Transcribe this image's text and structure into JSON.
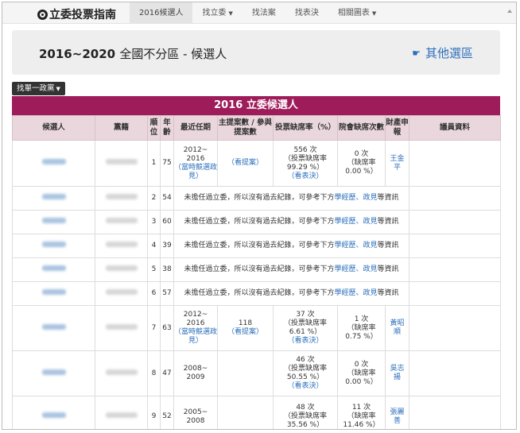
{
  "nav": {
    "brand": "立委投票指南",
    "items": [
      {
        "label": "2016候選人",
        "active": true,
        "caret": false
      },
      {
        "label": "找立委",
        "active": false,
        "caret": true
      },
      {
        "label": "找法案",
        "active": false,
        "caret": false
      },
      {
        "label": "找表決",
        "active": false,
        "caret": false
      },
      {
        "label": "相關圖表",
        "active": false,
        "caret": true
      }
    ]
  },
  "header": {
    "title_bold": "2016~2020",
    "title_normal": "全國不分區 - 候選人",
    "other_link": "其他選區"
  },
  "filter": {
    "label": "找單一政黨"
  },
  "table": {
    "title": "2016 立委候選人",
    "columns": [
      "候選人",
      "黨籍",
      "順位",
      "年齡",
      "最近任期",
      "主提案數 / 參與提案數",
      "投票缺席率（%）",
      "院會缺席次數",
      "財產申報",
      "議員資料"
    ],
    "rows": [
      {
        "rank": "1",
        "age": "75",
        "type": "record",
        "term": "2012~\n2016",
        "term_link": "（當時競選政見）",
        "bills": "",
        "bills_link": "（看提案）",
        "vote_count": "556 次",
        "vote_rate": "（投票缺席率\n99.29 %）",
        "vote_link": "（看表決）",
        "absent_count": "0 次",
        "absent_rate": "（缺席率\n0.00 %）",
        "asset": "王金\n平"
      },
      {
        "rank": "2",
        "age": "54",
        "type": "none",
        "note": "未擔任過立委，所以沒有過去紀錄，可參考下方",
        "note_link": "學經歷、政見",
        "note_end": "等資訊"
      },
      {
        "rank": "3",
        "age": "60",
        "type": "none",
        "note": "未擔任過立委，所以沒有過去紀錄，可參考下方",
        "note_link": "學經歷、政見",
        "note_end": "等資訊"
      },
      {
        "rank": "4",
        "age": "39",
        "type": "none",
        "note": "未擔任過立委，所以沒有過去紀錄，可參考下方",
        "note_link": "學經歷、政見",
        "note_end": "等資訊"
      },
      {
        "rank": "5",
        "age": "38",
        "type": "none",
        "note": "未擔任過立委，所以沒有過去紀錄，可參考下方",
        "note_link": "學經歷、政見",
        "note_end": "等資訊"
      },
      {
        "rank": "6",
        "age": "57",
        "type": "none",
        "note": "未擔任過立委，所以沒有過去紀錄，可參考下方",
        "note_link": "學經歷、政見",
        "note_end": "等資訊"
      },
      {
        "rank": "7",
        "age": "63",
        "type": "record",
        "term": "2012~\n2016",
        "term_link": "（當時競選政見）",
        "bills": "118",
        "bills_link": "（看提案）",
        "vote_count": "37 次",
        "vote_rate": "（投票缺席率\n6.61 %）",
        "vote_link": "（看表決）",
        "absent_count": "1 次",
        "absent_rate": "（缺席率\n0.75 %）",
        "asset": "黃昭\n順"
      },
      {
        "rank": "8",
        "age": "47",
        "type": "record",
        "term": "2008~\n2009",
        "term_link": "",
        "bills": "",
        "bills_link": "",
        "vote_count": "46 次",
        "vote_rate": "（投票缺席率\n50.55 %）",
        "vote_link": "（看表決）",
        "absent_count": "0 次",
        "absent_rate": "（缺席率\n0.00 %）",
        "asset": "吳志\n揚"
      },
      {
        "rank": "9",
        "age": "52",
        "type": "record",
        "term": "2005~\n2008",
        "term_link": "",
        "bills": "",
        "bills_link": "",
        "vote_count": "48 次",
        "vote_rate": "（投票缺席率\n35.56 %）",
        "vote_link": "",
        "absent_count": "11 次",
        "absent_rate": "（缺席率\n11.46 %）",
        "asset": "張麗\n善"
      }
    ]
  }
}
